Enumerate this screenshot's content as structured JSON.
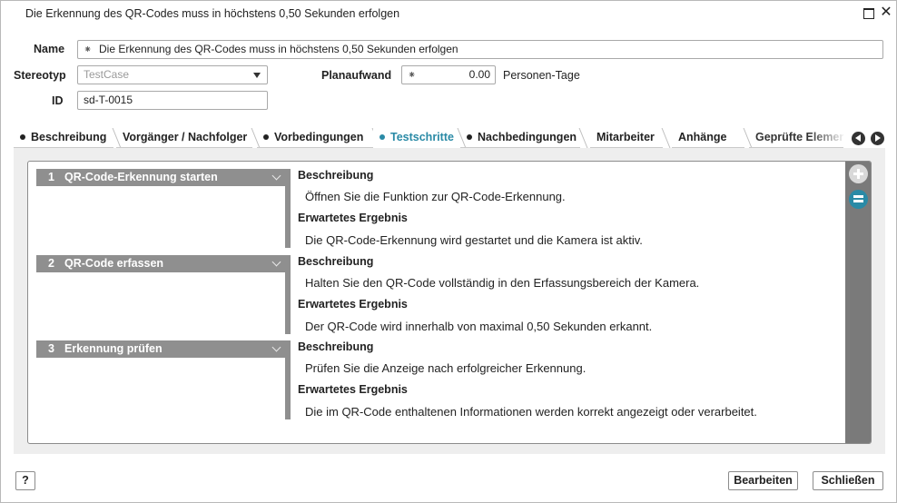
{
  "window": {
    "title": "Die Erkennung des QR-Codes muss in höchstens 0,50 Sekunden erfolgen",
    "maximize_glyph": "",
    "close_glyph": "✕"
  },
  "form": {
    "name_label": "Name",
    "name_required_mark": "⁕",
    "name_value": "Die Erkennung des QR-Codes muss in höchstens 0,50 Sekunden erfolgen",
    "stereotype_label": "Stereotyp",
    "stereotype_value": "TestCase",
    "id_label": "ID",
    "id_value": "sd-T-0015",
    "effort_label": "Planaufwand",
    "effort_required_mark": "⁕",
    "effort_value": "0.00",
    "effort_unit": "Personen-Tage"
  },
  "tabs": [
    {
      "label": "Beschreibung",
      "dot": true,
      "active": false
    },
    {
      "label": "Vorgänger / Nachfolger",
      "dot": false,
      "active": false
    },
    {
      "label": "Vorbedingungen",
      "dot": true,
      "active": false
    },
    {
      "label": "Testschritte",
      "dot": true,
      "active": true
    },
    {
      "label": "Nachbedingungen",
      "dot": true,
      "active": false
    },
    {
      "label": "Mitarbeiter",
      "dot": false,
      "active": false
    },
    {
      "label": "Anhänge",
      "dot": false,
      "active": false
    },
    {
      "label": "Geprüfte Elemen",
      "dot": false,
      "active": false
    }
  ],
  "steps": [
    {
      "number": "1",
      "title": "QR-Code-Erkennung starten",
      "description_label": "Beschreibung",
      "description": "Öffnen Sie die Funktion zur QR-Code-Erkennung.",
      "expected_label": "Erwartetes Ergebnis",
      "expected": "Die QR-Code-Erkennung wird gestartet und die Kamera ist aktiv."
    },
    {
      "number": "2",
      "title": "QR-Code erfassen",
      "description_label": "Beschreibung",
      "description": "Halten Sie den QR-Code vollständig in den Erfassungsbereich der Kamera.",
      "expected_label": "Erwartetes Ergebnis",
      "expected": "Der QR-Code wird innerhalb von maximal 0,50 Sekunden erkannt."
    },
    {
      "number": "3",
      "title": "Erkennung prüfen",
      "description_label": "Beschreibung",
      "description": "Prüfen Sie die Anzeige nach erfolgreicher Erkennung.",
      "expected_label": "Erwartetes Ergebnis",
      "expected": "Die im QR-Code enthaltenen Informationen werden korrekt angezeigt oder verarbeitet."
    }
  ],
  "footer": {
    "help_label": "?",
    "edit_label": "Bearbeiten",
    "close_label": "Schließen"
  },
  "colors": {
    "accent": "#2a8aa6",
    "step_header": "#8f8f8f",
    "side_bar": "#7a7a7a"
  },
  "icons": {
    "add_step": "plus-circle-icon",
    "step_list": "list-icon",
    "tab_prev": "chevron-left-circle-icon",
    "tab_next": "chevron-right-circle-icon",
    "step_collapse": "chevron-down-icon"
  }
}
